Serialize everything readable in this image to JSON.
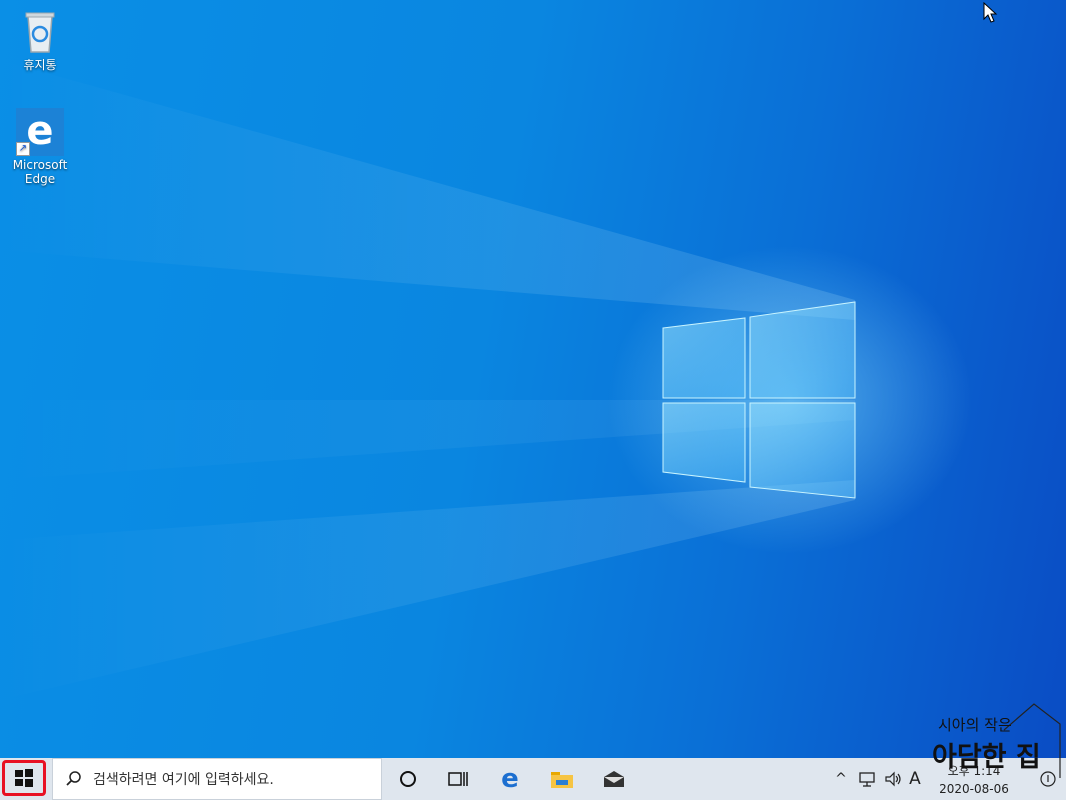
{
  "desktop": {
    "icons": [
      {
        "label": "휴지통",
        "icon": "recycle-bin-icon"
      },
      {
        "label": "Microsoft Edge",
        "icon": "edge-icon"
      }
    ]
  },
  "taskbar": {
    "start": {
      "icon": "windows-logo-icon"
    },
    "search": {
      "placeholder": "검색하려면 여기에 입력하세요.",
      "icon": "search-icon"
    },
    "buttons": [
      {
        "icon": "cortana-icon"
      },
      {
        "icon": "task-view-icon"
      },
      {
        "icon": "edge-icon"
      },
      {
        "icon": "file-explorer-icon"
      },
      {
        "icon": "mail-icon"
      }
    ],
    "tray": {
      "chevron": "^",
      "ime": "A",
      "time": "오후 1:14",
      "date": "2020-08-06"
    }
  },
  "watermark": {
    "line1": "시아의 작은",
    "line2": "아담한 집"
  },
  "colors": {
    "accent": "#0078d7",
    "start_highlight": "#e81123",
    "taskbar": "#dfe6ee"
  }
}
